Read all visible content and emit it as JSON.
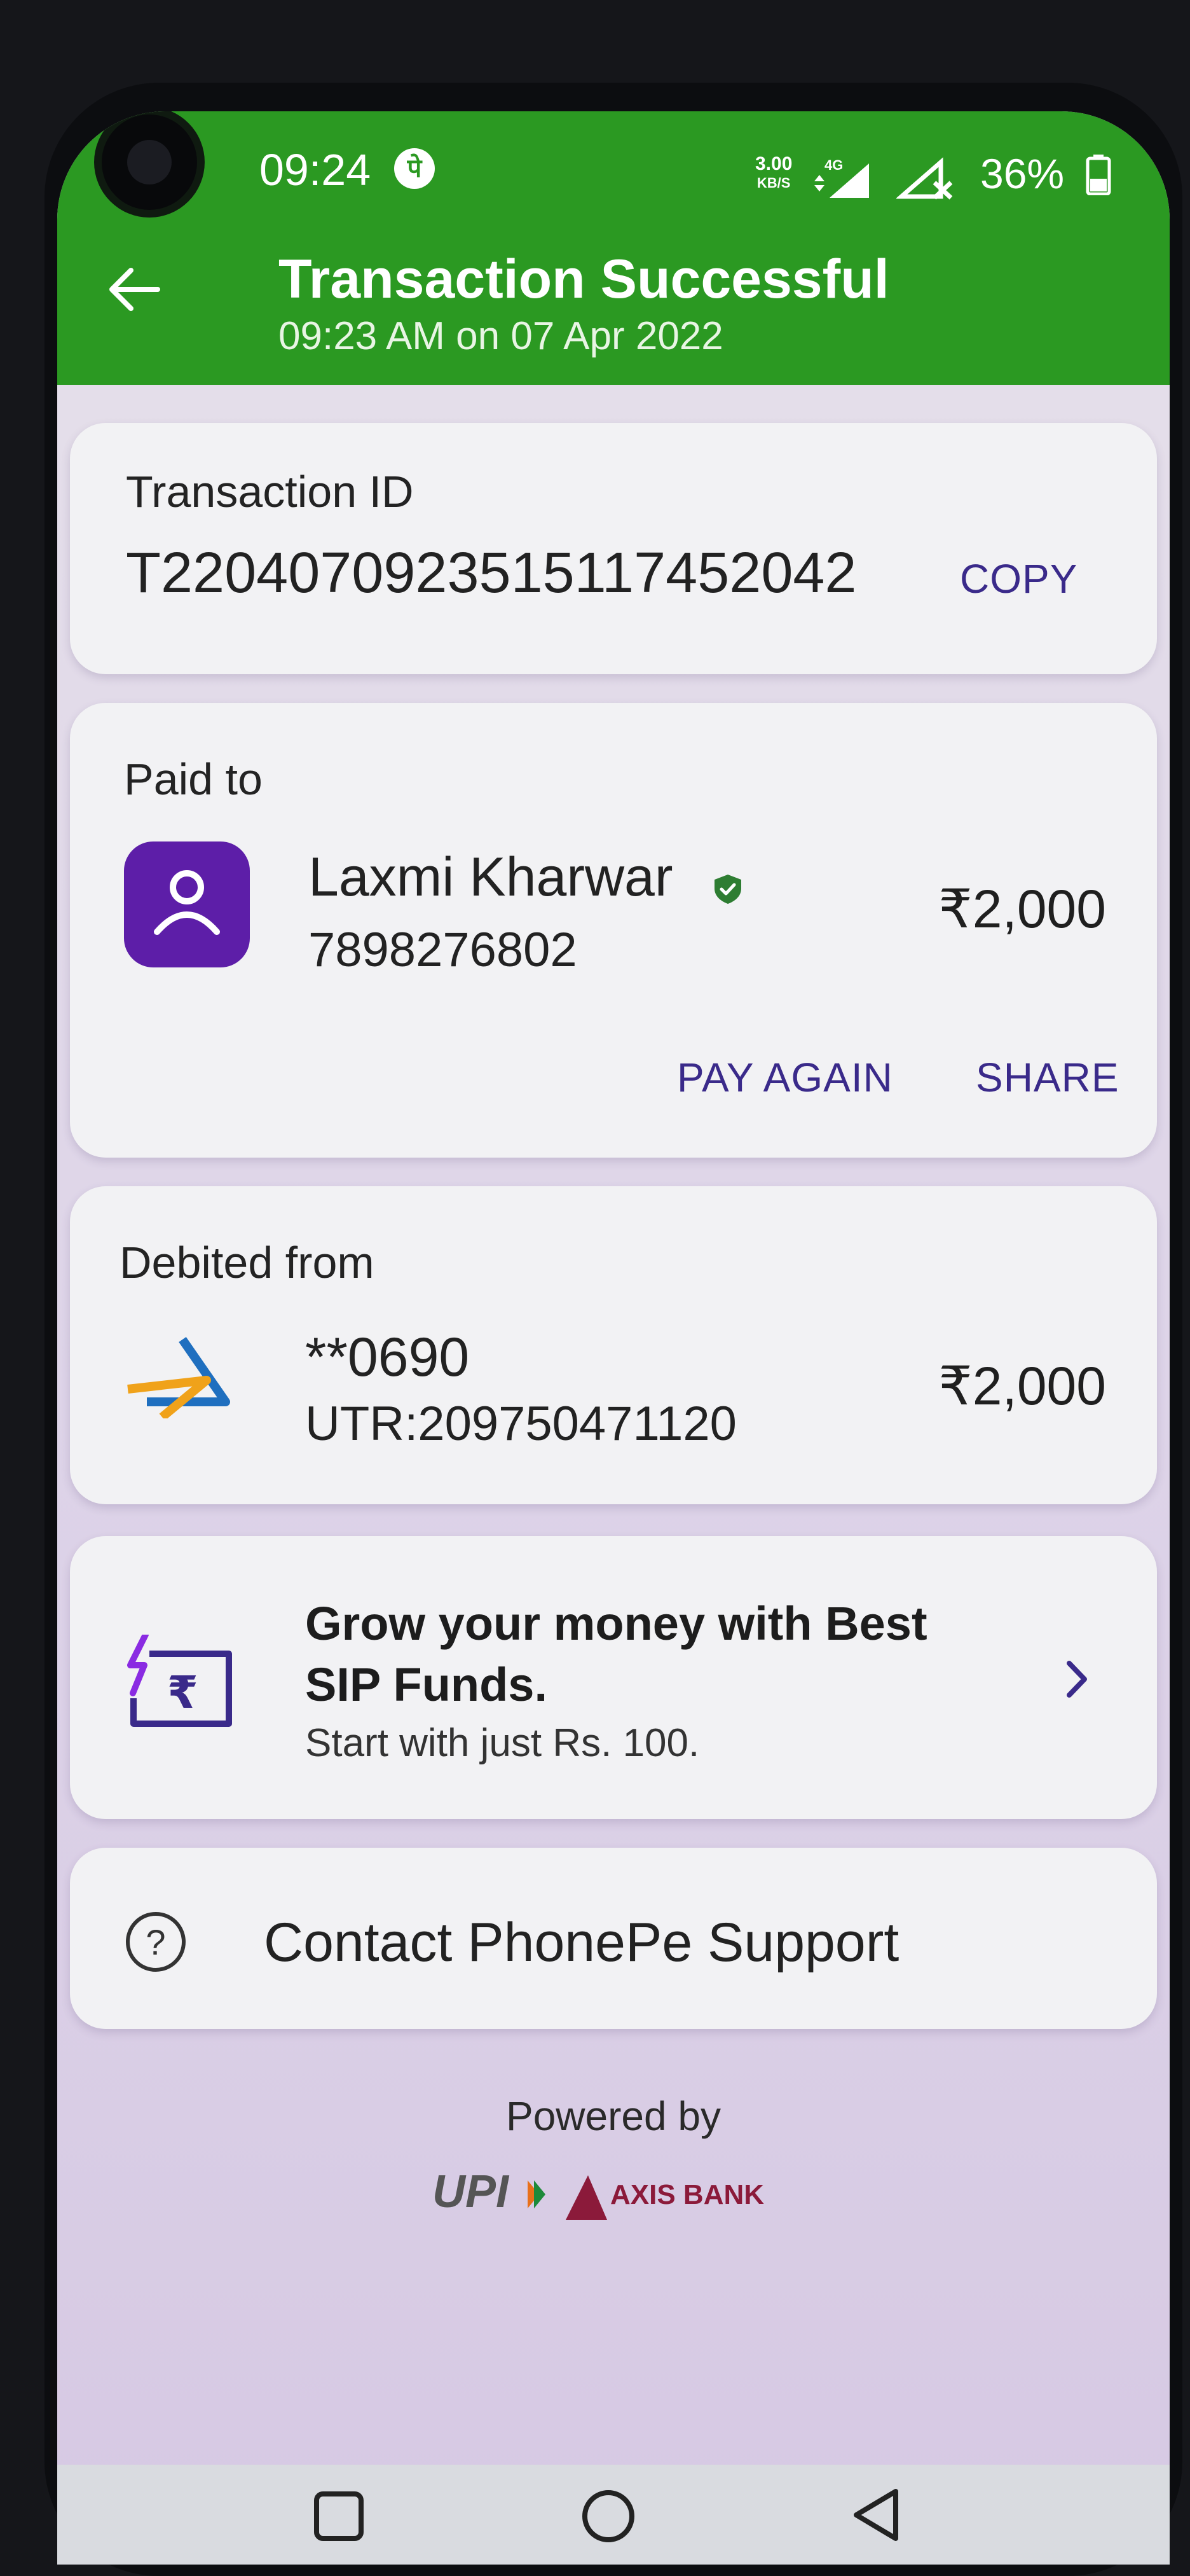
{
  "status_bar": {
    "time": "09:24",
    "badge": "पे",
    "net_speed_value": "3.00",
    "net_speed_unit": "KB/S",
    "network": "4G",
    "battery": "36%"
  },
  "header": {
    "title": "Transaction Successful",
    "subtitle": "09:23 AM on 07 Apr 2022",
    "color": "#2b9922"
  },
  "transaction": {
    "label": "Transaction ID",
    "id": "T2204070923515117452042",
    "copy_label": "COPY"
  },
  "paid_to": {
    "label": "Paid to",
    "name": "Laxmi Kharwar",
    "phone": "7898276802",
    "amount": "₹2,000",
    "pay_again_label": "PAY AGAIN",
    "share_label": "SHARE"
  },
  "debited_from": {
    "label": "Debited from",
    "account": "**0690",
    "utr": "UTR:209750471120",
    "amount": "₹2,000"
  },
  "promo": {
    "title": "Grow your money with Best SIP Funds.",
    "subtitle": "Start with just Rs. 100."
  },
  "support": {
    "label": "Contact PhonePe Support"
  },
  "footer": {
    "powered_by": "Powered by",
    "upi_logo": "UPI",
    "bank_logo": "AXIS BANK"
  },
  "icons": {
    "back": "back-arrow-icon",
    "verified": "verified-shield-icon",
    "avatar": "person-icon",
    "bank": "sbi-bank-icon",
    "promo": "rupee-card-icon",
    "chevron": "chevron-right-icon",
    "help": "help-circle-icon"
  },
  "colors": {
    "accent": "#3a2a8a",
    "avatar_bg": "#5d1ea8"
  }
}
